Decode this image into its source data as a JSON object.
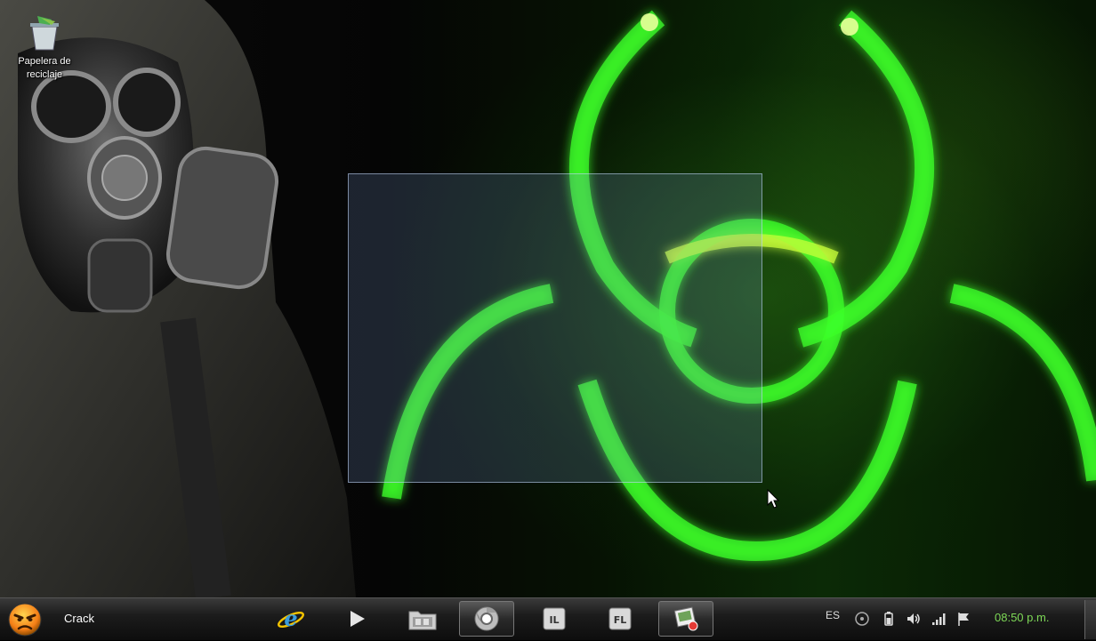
{
  "desktop": {
    "icons": [
      {
        "label_line1": "Papelera de",
        "label_line2": "reciclaje",
        "icon": "recycle-bin-icon"
      }
    ]
  },
  "taskbar": {
    "user_name": "Crack",
    "apps": [
      {
        "name": "internet-explorer",
        "icon": "internet-explorer-icon"
      },
      {
        "name": "media-player",
        "icon": "play-icon"
      },
      {
        "name": "file-explorer",
        "icon": "folder-icon"
      },
      {
        "name": "chrome",
        "icon": "chrome-icon",
        "active": true
      },
      {
        "name": "app-il",
        "icon": "il-icon",
        "glyph": "IL"
      },
      {
        "name": "app-fl",
        "icon": "fl-icon",
        "glyph": "FL"
      },
      {
        "name": "image-app",
        "icon": "image-app-icon",
        "active": true
      }
    ],
    "tray": {
      "language": "ES",
      "clock": "08:50 p.m."
    }
  },
  "colors": {
    "clock": "#7ed957",
    "accent_green": "#3cff2a"
  }
}
